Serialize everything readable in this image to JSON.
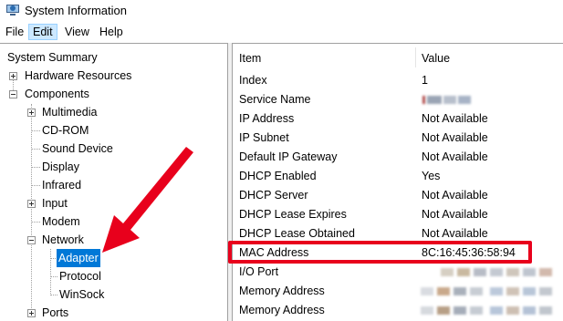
{
  "window": {
    "title": "System Information",
    "icon": "system-information-icon"
  },
  "menu": [
    {
      "label": "File",
      "selected": false
    },
    {
      "label": "Edit",
      "selected": true
    },
    {
      "label": "View",
      "selected": false
    },
    {
      "label": "Help",
      "selected": false
    }
  ],
  "tree": {
    "root": "System Summary",
    "hardware_resources": "Hardware Resources",
    "components": "Components",
    "multimedia": "Multimedia",
    "cdrom": "CD-ROM",
    "sound_device": "Sound Device",
    "display": "Display",
    "infrared": "Infrared",
    "input": "Input",
    "modem": "Modem",
    "network": "Network",
    "adapter": "Adapter",
    "protocol": "Protocol",
    "winsock": "WinSock",
    "ports": "Ports"
  },
  "table": {
    "headers": {
      "item": "Item",
      "value": "Value"
    },
    "rows": [
      {
        "item": "Index",
        "value": "1"
      },
      {
        "item": "Service Name",
        "value": ""
      },
      {
        "item": "IP Address",
        "value": "Not Available"
      },
      {
        "item": "IP Subnet",
        "value": "Not Available"
      },
      {
        "item": "Default IP Gateway",
        "value": "Not Available"
      },
      {
        "item": "DHCP Enabled",
        "value": "Yes"
      },
      {
        "item": "DHCP Server",
        "value": "Not Available"
      },
      {
        "item": "DHCP Lease Expires",
        "value": "Not Available"
      },
      {
        "item": "DHCP Lease Obtained",
        "value": "Not Available"
      },
      {
        "item": "MAC Address",
        "value": "8C:16:45:36:58:94"
      },
      {
        "item": "I/O Port",
        "value": ""
      },
      {
        "item": "Memory Address",
        "value": ""
      },
      {
        "item": "Memory Address",
        "value": ""
      }
    ]
  },
  "colors": {
    "selection": "#0078d7",
    "annotation": "#e8001c",
    "menu_highlight": "#cce8ff"
  }
}
